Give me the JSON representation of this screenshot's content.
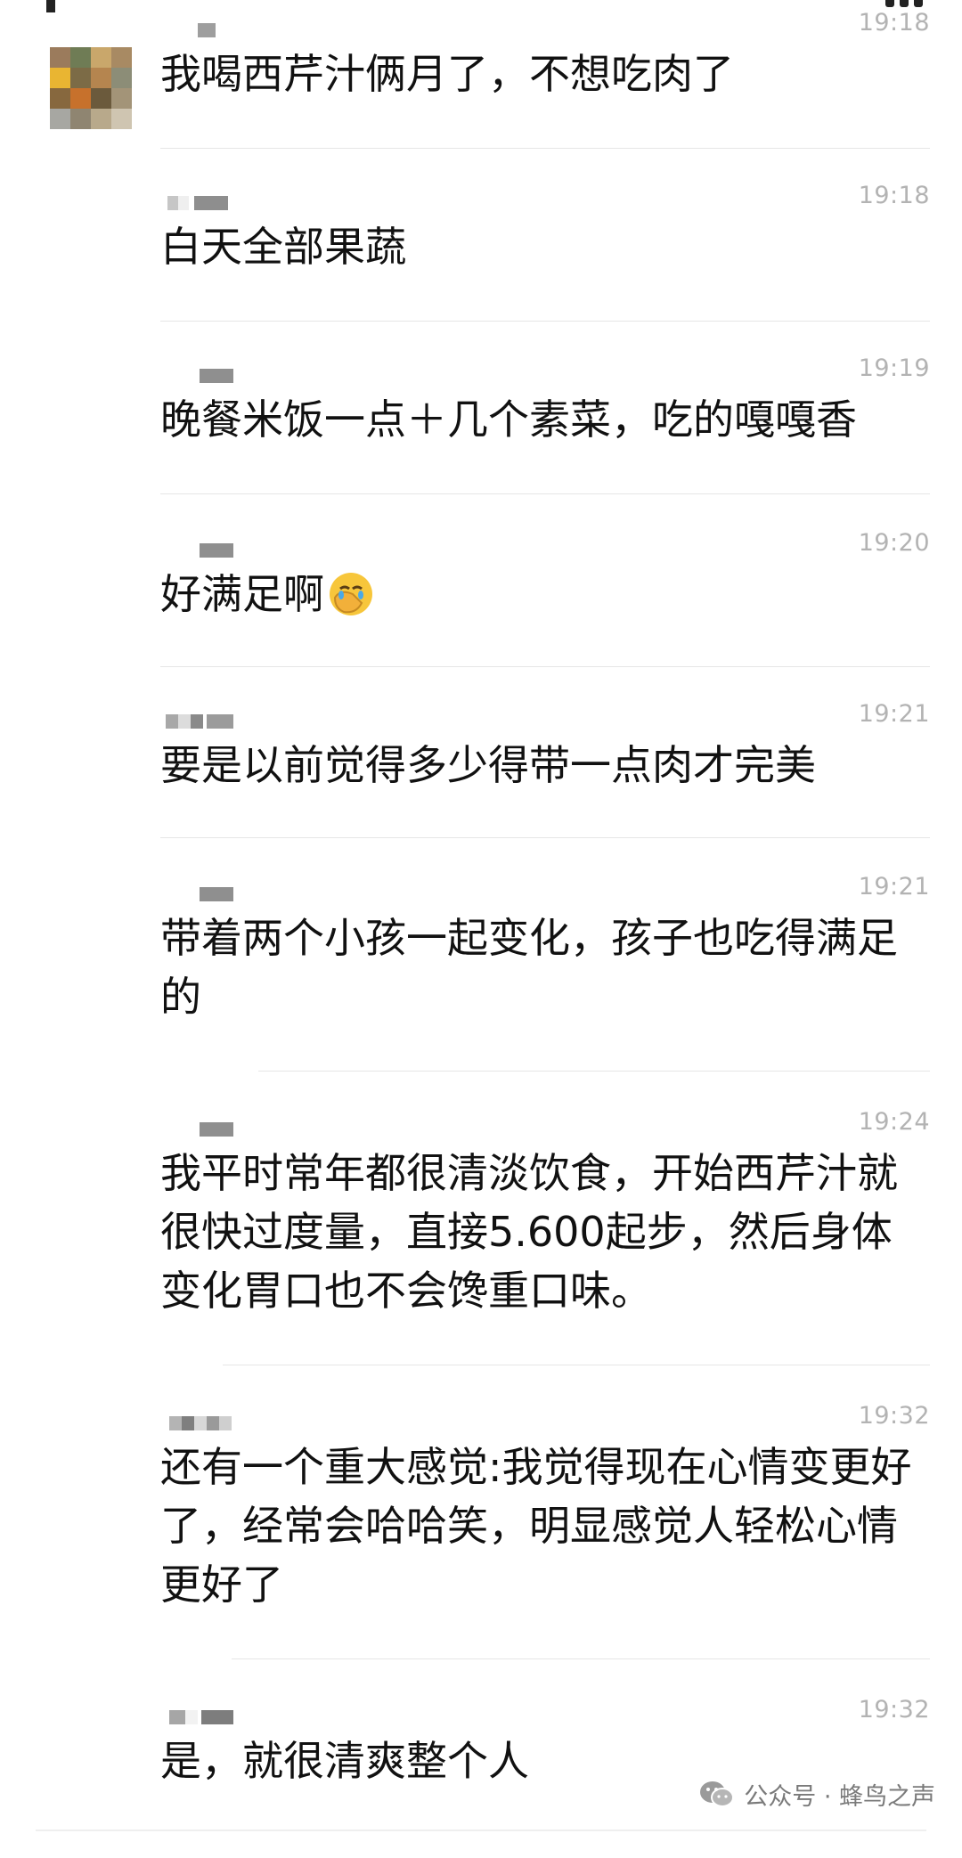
{
  "messages": [
    {
      "time": "19:18",
      "text": "我喝西芹汁俩月了，不想吃肉了"
    },
    {
      "time": "19:18",
      "text": "白天全部果蔬"
    },
    {
      "time": "19:19",
      "text": "晚餐米饭一点＋几个素菜，吃的嘎嘎香"
    },
    {
      "time": "19:20",
      "text": "好满足啊"
    },
    {
      "time": "19:21",
      "text": "要是以前觉得多少得带一点肉才完美"
    },
    {
      "time": "19:21",
      "text": "带着两个小孩一起变化，孩子也吃得满足的"
    },
    {
      "time": "19:24",
      "text": "我平时常年都很清淡饮食，开始西芹汁就很快过度量，直接5.600起步，然后身体变化胃口也不会馋重口味。"
    },
    {
      "time": "19:32",
      "text": "还有一个重大感觉:我觉得现在心情变更好了，经常会哈哈笑，明显感觉人轻松心情更好了"
    },
    {
      "time": "19:32",
      "text": "是，就很清爽整个人"
    }
  ],
  "watermark": {
    "label": "公众号 · 蜂鸟之声",
    "icon": "wechat-icon"
  },
  "colors": {
    "time": "#b3b3b3",
    "divider": "#e6e6e6",
    "text": "#111111"
  }
}
